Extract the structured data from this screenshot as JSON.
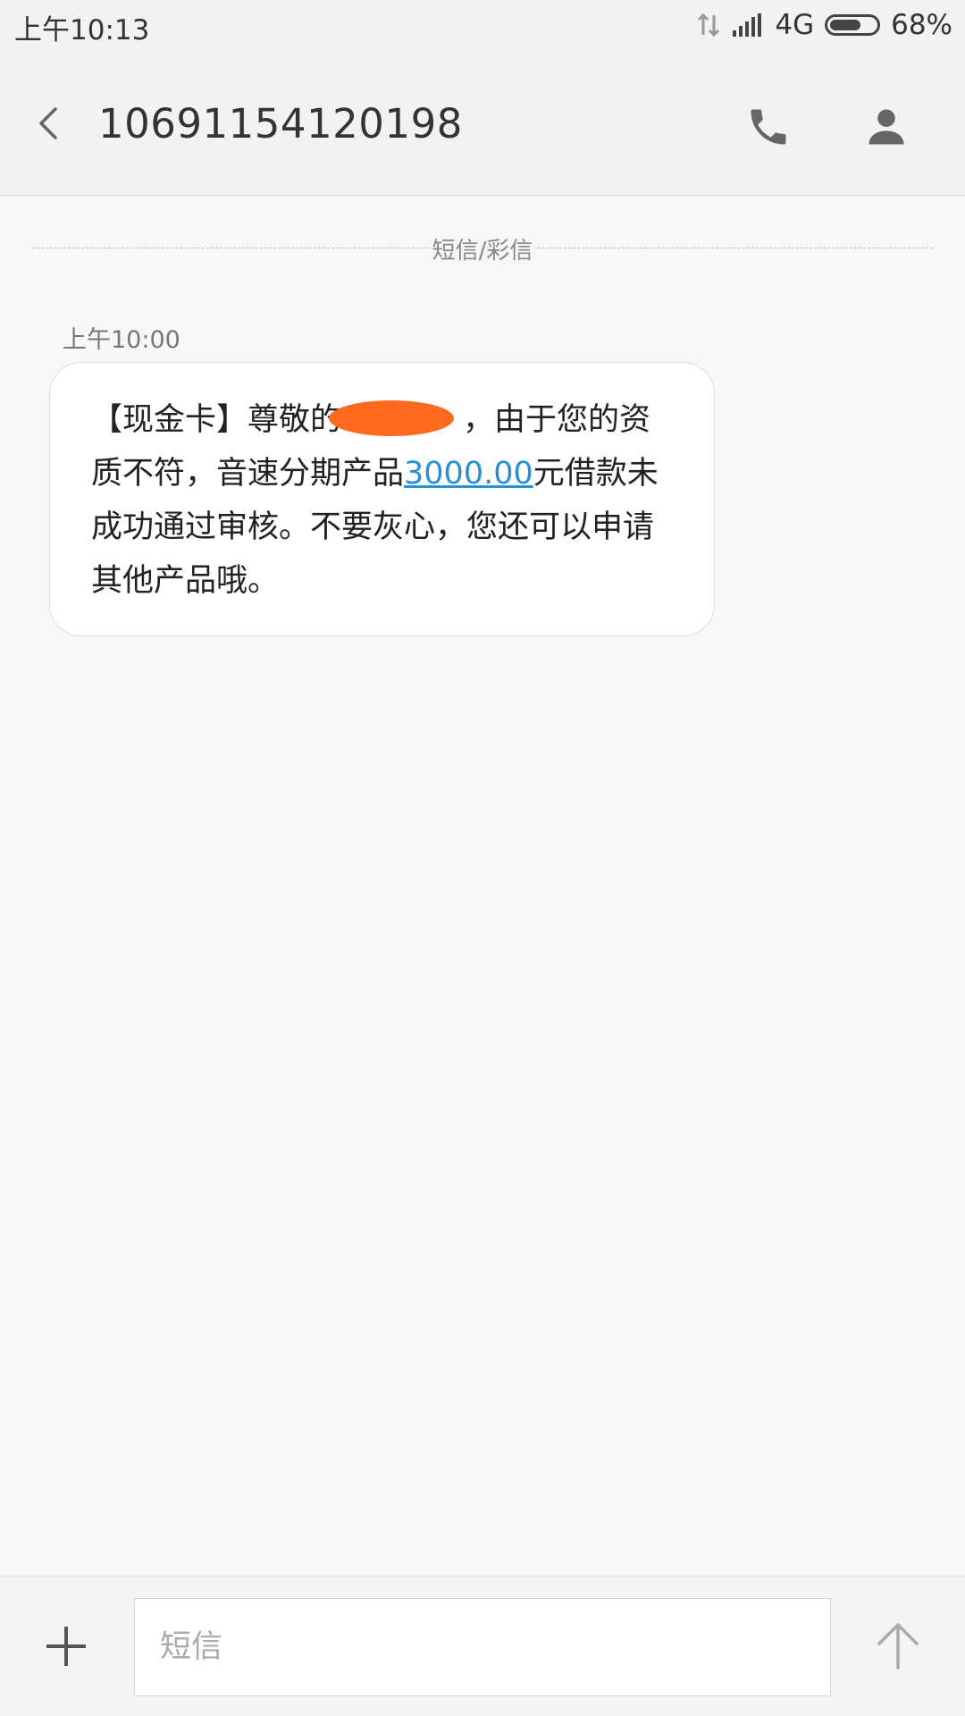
{
  "status_bar": {
    "time": "上午10:13",
    "network": "4G",
    "battery_text": "68%",
    "battery_level": 0.68,
    "icons": [
      "data-transfer-icon",
      "signal-icon",
      "battery-icon"
    ]
  },
  "header": {
    "title": "10691154120198",
    "icons": [
      "back-arrow-icon",
      "phone-icon",
      "person-icon"
    ]
  },
  "conversation": {
    "channel_label": "短信/彩信",
    "messages": [
      {
        "time": "上午10:00",
        "text_before": "【现金卡】尊敬的",
        "text_middle": "，由于您的资质不符，音速分期产品",
        "link": "3000.00",
        "text_after": "元借款未成功通过审核。不要灰心，您还可以申请其他产品哦。"
      }
    ]
  },
  "composer": {
    "placeholder": "短信",
    "value": "",
    "icons": [
      "plus-icon",
      "send-arrow-icon"
    ]
  },
  "colors": {
    "link": "#2b8fd6",
    "redaction": "#ff6a1f",
    "background": "#f7f7f7"
  }
}
